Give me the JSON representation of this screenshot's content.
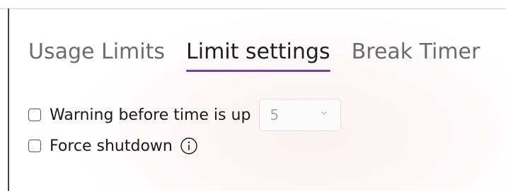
{
  "tabs": [
    {
      "label": "Usage Limits",
      "active": false
    },
    {
      "label": "Limit settings",
      "active": true
    },
    {
      "label": "Break Timer",
      "active": false
    }
  ],
  "options": {
    "warning": {
      "label": "Warning before time is up",
      "checked": false,
      "dropdown_value": "5"
    },
    "force_shutdown": {
      "label": "Force shutdown",
      "checked": false
    }
  },
  "icons": {
    "info": "info-icon",
    "dropdown": "chevron-down-icon"
  },
  "colors": {
    "accent": "#7a3ea8"
  }
}
